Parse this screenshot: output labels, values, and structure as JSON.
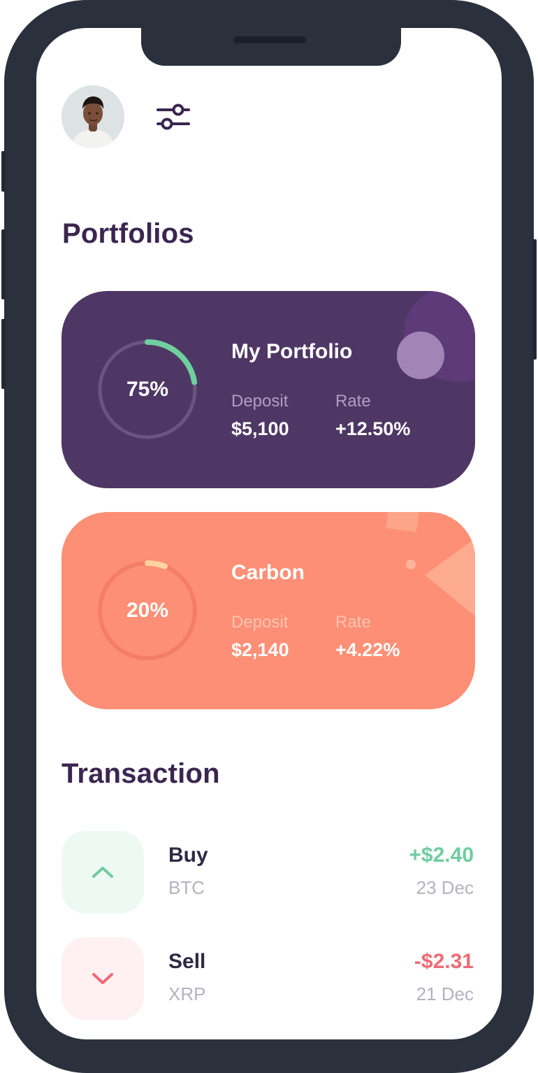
{
  "header": {
    "avatar_icon": "user-avatar-photo",
    "filter_icon": "sliders-icon"
  },
  "portfolios": {
    "title": "Portfolios",
    "cards": [
      {
        "name": "My Portfolio",
        "percent_label": "75%",
        "progress": 0.75,
        "deposit_label": "Deposit",
        "deposit_value": "$5,100",
        "rate_label": "Rate",
        "rate_value": "+12.50%",
        "background": "#4f3765",
        "accent": "#6fcf9e"
      },
      {
        "name": "Carbon",
        "percent_label": "20%",
        "progress": 0.2,
        "deposit_label": "Deposit",
        "deposit_value": "$2,140",
        "rate_label": "Rate",
        "rate_value": "+4.22%",
        "background": "#fc8f75",
        "accent": "#ffd3a1"
      }
    ]
  },
  "transactions": {
    "title": "Transaction",
    "items": [
      {
        "type": "Buy",
        "coin": "BTC",
        "amount": "+$2.40",
        "date": "23 Dec",
        "direction": "up",
        "amount_color": "#6fcca0",
        "icon_bg": "#eef9f4",
        "icon": "chevron-up-icon"
      },
      {
        "type": "Sell",
        "coin": "XRP",
        "amount": "-$2.31",
        "date": "21 Dec",
        "direction": "down",
        "amount_color": "#ee6a76",
        "icon_bg": "#fff0f1",
        "icon": "chevron-down-icon"
      }
    ]
  },
  "colors": {
    "title": "#3b2650",
    "purple_card": "#4f3765",
    "orange_card": "#fc8f75",
    "positive": "#6fcca0",
    "negative": "#ee6a76"
  }
}
